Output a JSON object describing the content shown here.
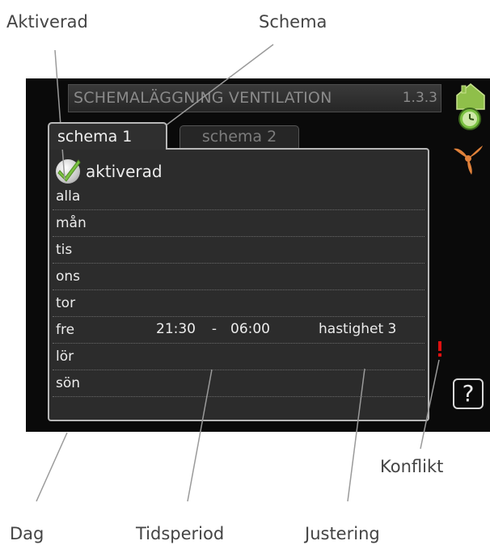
{
  "callouts": {
    "activated": "Aktiverad",
    "schedule": "Schema",
    "day": "Dag",
    "time_period": "Tidsperiod",
    "adjustment": "Justering",
    "conflict": "Konflikt"
  },
  "screen": {
    "title": "SCHEMALÄGGNING VENTILATION",
    "menu_number": "1.3.3",
    "tabs": [
      {
        "label": "schema 1",
        "selected": true
      },
      {
        "label": "schema 2",
        "selected": false
      }
    ],
    "activated_label": "aktiverad",
    "activated_checked": true,
    "days": [
      {
        "day": "alla",
        "start": "",
        "separator": "",
        "end": "",
        "setting": ""
      },
      {
        "day": "mån",
        "start": "",
        "separator": "",
        "end": "",
        "setting": ""
      },
      {
        "day": "tis",
        "start": "",
        "separator": "",
        "end": "",
        "setting": ""
      },
      {
        "day": "ons",
        "start": "",
        "separator": "",
        "end": "",
        "setting": ""
      },
      {
        "day": "tor",
        "start": "",
        "separator": "",
        "end": "",
        "setting": ""
      },
      {
        "day": "fre",
        "start": "21:30",
        "separator": "-",
        "end": "06:00",
        "setting": "hastighet 3"
      },
      {
        "day": "lör",
        "start": "",
        "separator": "",
        "end": "",
        "setting": ""
      },
      {
        "day": "sön",
        "start": "",
        "separator": "",
        "end": "",
        "setting": ""
      }
    ],
    "conflict_marker": "!",
    "help_label": "?"
  },
  "icons": {
    "house": "house-icon",
    "clock": "clock-icon",
    "fan": "fan-icon",
    "check": "checkmark-icon"
  },
  "colors": {
    "screen_bg": "#0a0a0a",
    "panel_bg": "#2c2c2c",
    "accent_green": "#7cc242",
    "fan_orange": "#e0813a",
    "conflict_red": "#e01010",
    "text_light": "#ececec",
    "text_dim": "#8a8a8a"
  }
}
